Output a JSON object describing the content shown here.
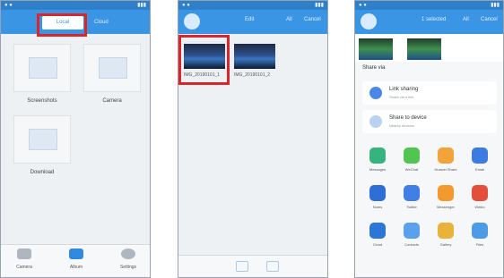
{
  "phone1": {
    "tab_local": "Local",
    "tab_other": "Cloud",
    "folders": [
      "Screenshots",
      "Camera",
      "Download"
    ],
    "nav": [
      "Camera",
      "Album",
      "Settings"
    ]
  },
  "phone2": {
    "header_title": "Edit",
    "header_action1": "All",
    "header_action2": "Cancel",
    "photos": [
      {
        "caption": "IMG_20190101_1"
      },
      {
        "caption": "IMG_20190101_2"
      }
    ]
  },
  "phone3": {
    "header_title": "1 selected",
    "header_action1": "All",
    "header_action2": "Cancel",
    "share_title": "Share via",
    "cards": [
      {
        "title": "Link sharing",
        "sub": "Share via a link"
      },
      {
        "title": "Share to device",
        "sub": "Nearby devices"
      }
    ],
    "apps": [
      [
        "Messages",
        "WeChat",
        "Huawei Share",
        "Email"
      ],
      [
        "Notes",
        "Twitter",
        "Messenger",
        "Weibo"
      ],
      [
        "Cloud",
        "Contacts",
        "Gallery",
        "Files"
      ]
    ]
  },
  "colors": {
    "header_blue": "#3a95e4",
    "status_blue": "#2f7fc9",
    "highlight_red": "#d8262c"
  }
}
